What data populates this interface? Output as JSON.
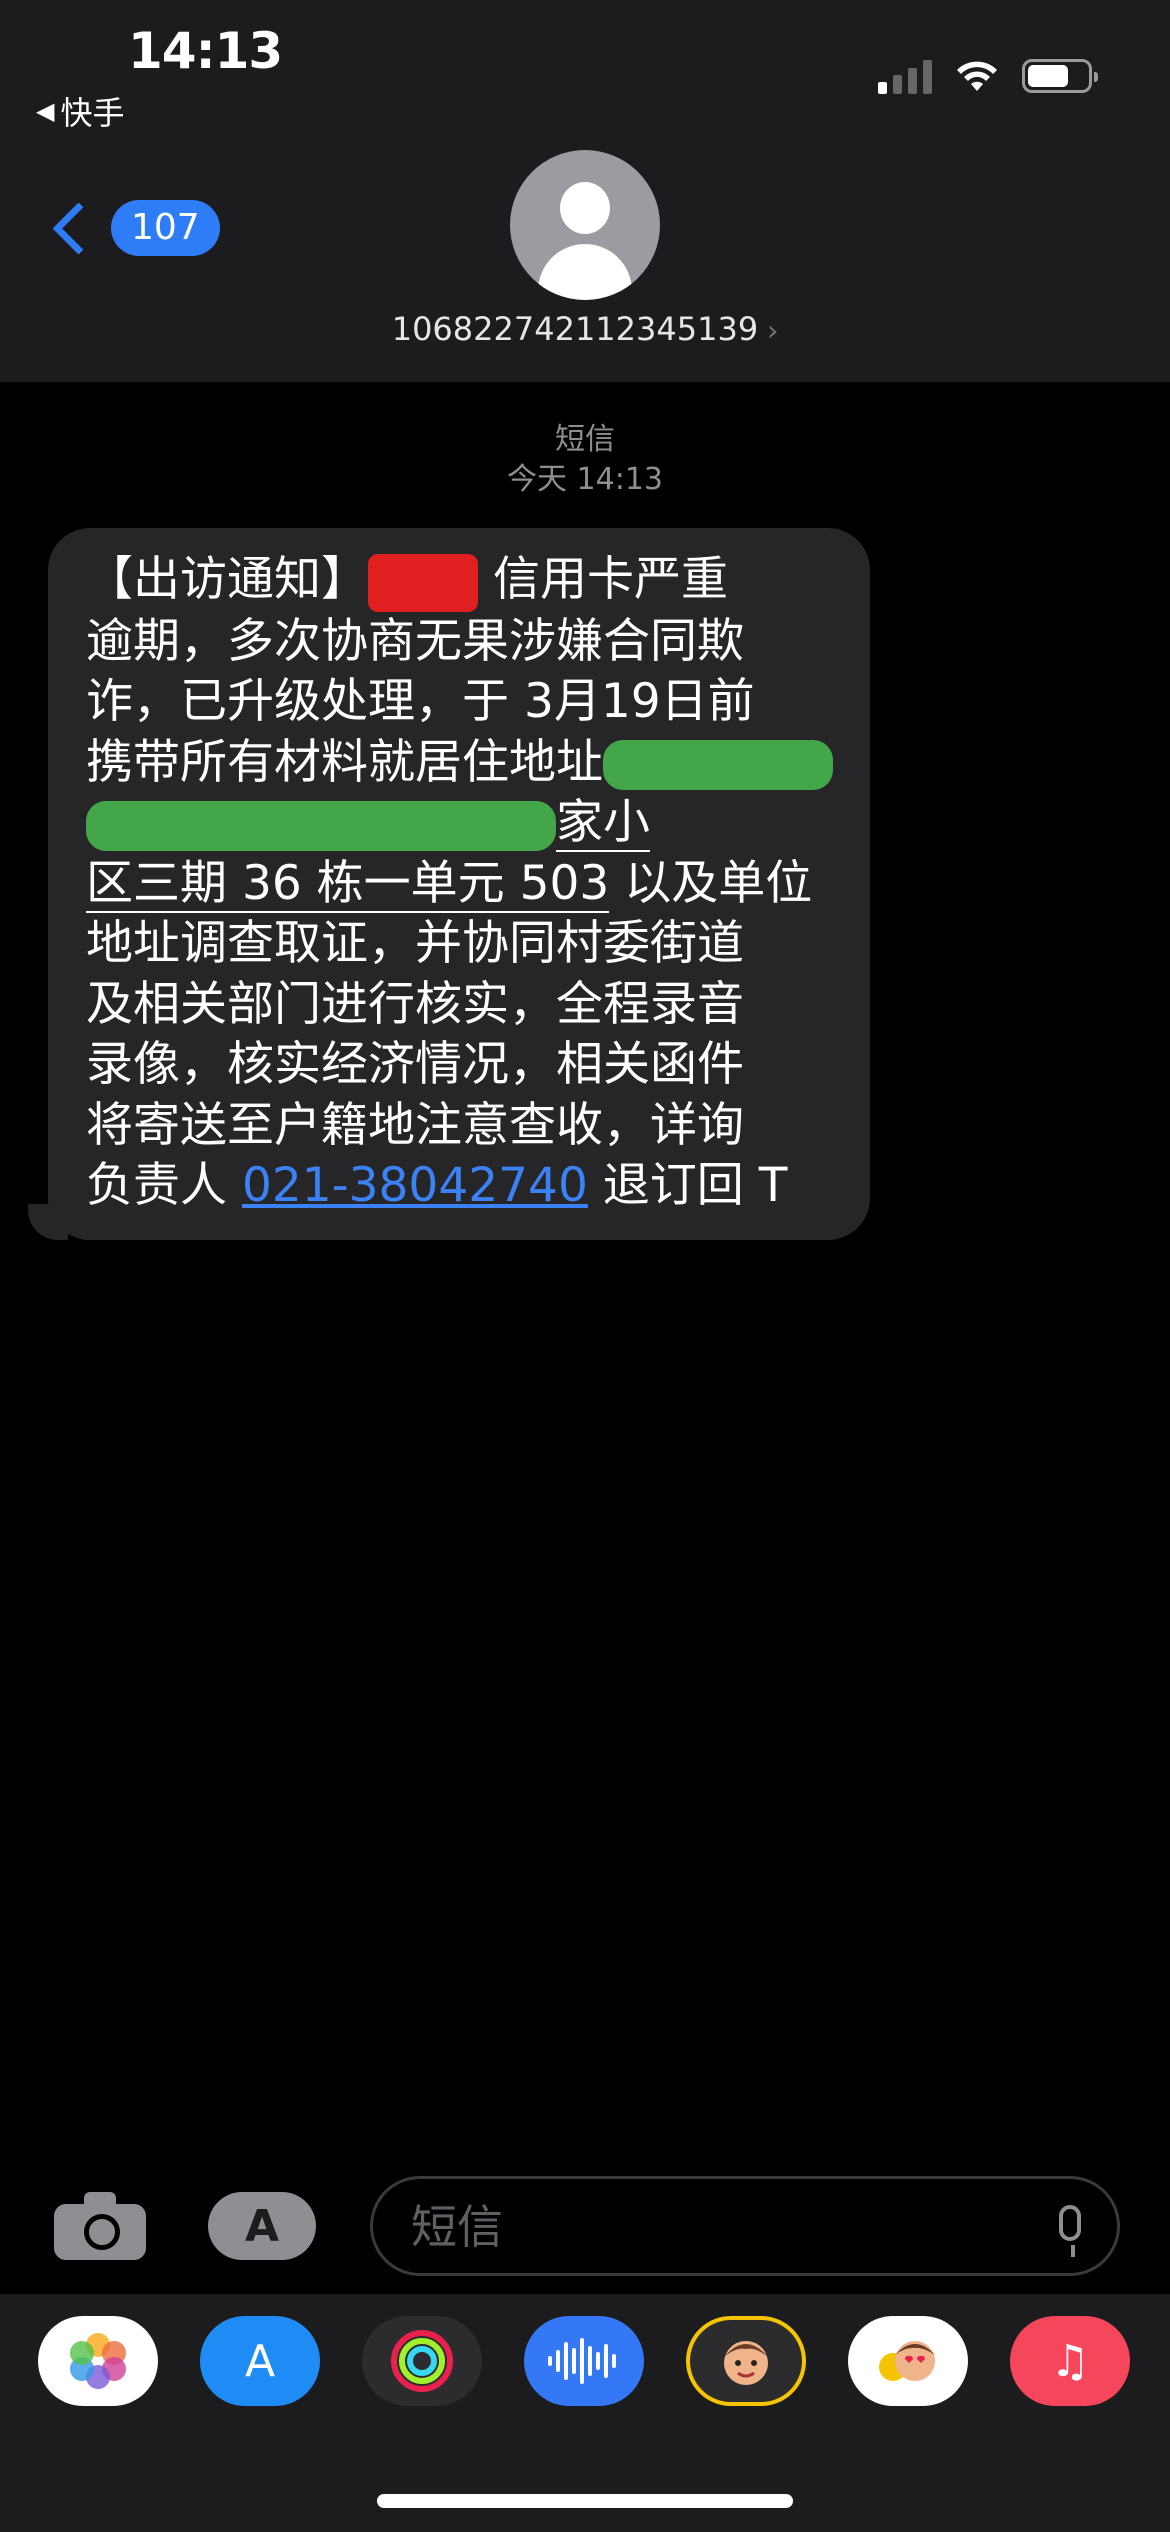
{
  "status_bar": {
    "time": "14:13",
    "back_app": "快手"
  },
  "header": {
    "back_count": "107",
    "contact_number": "106822742112345139"
  },
  "thread": {
    "service_label": "短信",
    "timestamp": "今天 14:13",
    "message_lines": {
      "l1_a": "【出访通知】",
      "l1_b": " 信用卡严重",
      "l2": "逾期，多次协商无果涉嫌合同欺",
      "l3": "诈，已升级处理，于 3月19日前",
      "l4": "携带所有材料就居住地址",
      "l5_tail": "家小",
      "l6_ul": "区三期 36 栋一单元 503",
      "l6_rest": " 以及单位",
      "l7": "地址调查取证，并协同村委街道",
      "l8": "及相关部门进行核实，全程录音",
      "l9": "录像，核实经济情况，相关函件",
      "l10": "将寄送至户籍地注意查收，详询",
      "l11_a": "负责人 ",
      "l11_phone": "021-38042740",
      "l11_b": " 退订回 T"
    }
  },
  "input": {
    "placeholder": "短信"
  },
  "app_drawer": [
    {
      "name": "photos-icon",
      "color": "#ffffff"
    },
    {
      "name": "app-store-icon",
      "color": "#1f8cf5"
    },
    {
      "name": "fitness-icon",
      "color": "#2c2c2e"
    },
    {
      "name": "audio-icon",
      "color": "#3478f6"
    },
    {
      "name": "memoji-icon",
      "color": "#2c2c2e"
    },
    {
      "name": "memoji-stickers-icon",
      "color": "#ffffff"
    },
    {
      "name": "music-icon",
      "color": "#f5465c"
    }
  ],
  "colors": {
    "accent": "#2f7df6",
    "bubble": "#262628",
    "header": "#1c1c1e",
    "link": "#3b82f6"
  }
}
